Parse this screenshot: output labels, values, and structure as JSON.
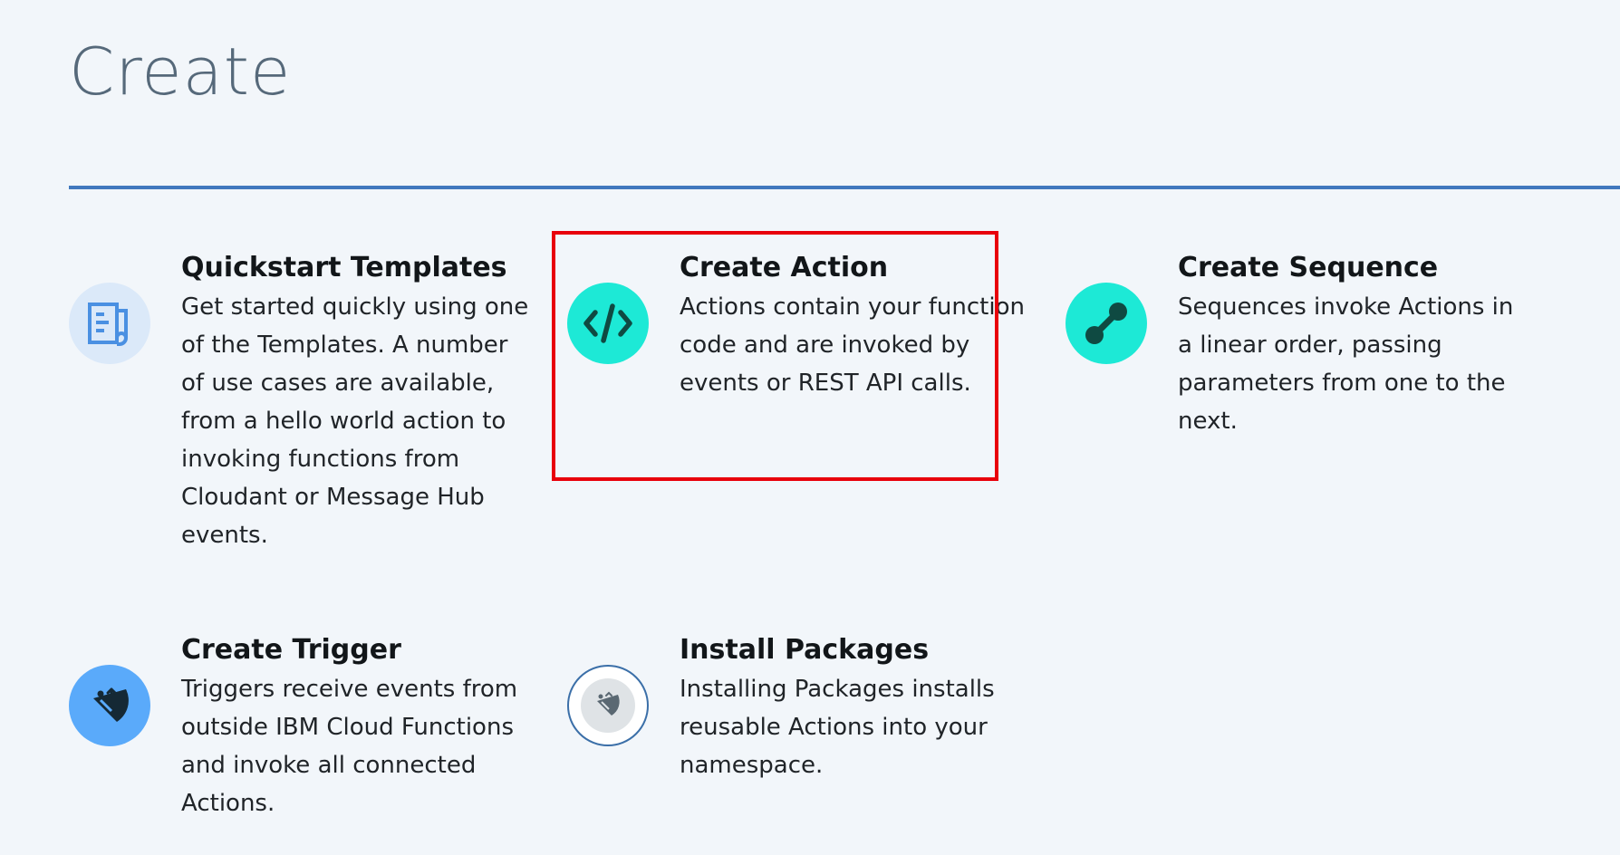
{
  "page": {
    "title": "Create"
  },
  "colors": {
    "background": "#f2f6fa",
    "title": "#56697a",
    "divider": "#4178be",
    "highlight": "#e8000b",
    "teal_icon": "#1de9d6",
    "blue_icon": "#5aaafa",
    "pale_blue_icon": "#dbe9f9"
  },
  "tiles": [
    {
      "id": "quickstart",
      "icon": "template-document-icon",
      "title": "Quickstart Templates",
      "description": "Get started quickly using one of the Templates. A number of use cases are available, from a hello world action to invoking functions from Cloudant or Message Hub events."
    },
    {
      "id": "action",
      "icon": "code-brackets-icon",
      "title": "Create Action",
      "description": "Actions contain your function code and are invoked by events or REST API calls."
    },
    {
      "id": "sequence",
      "icon": "connected-nodes-icon",
      "title": "Create Sequence",
      "description": "Sequences invoke Actions in a linear order, passing parameters from one to the next."
    },
    {
      "id": "trigger",
      "icon": "satellite-dish-icon",
      "title": "Create Trigger",
      "description": "Triggers receive events from outside IBM Cloud Functions and invoke all connected Actions."
    },
    {
      "id": "packages",
      "icon": "package-dish-icon",
      "title": "Install Packages",
      "description": "Installing Packages installs reusable Actions into your namespace."
    }
  ]
}
